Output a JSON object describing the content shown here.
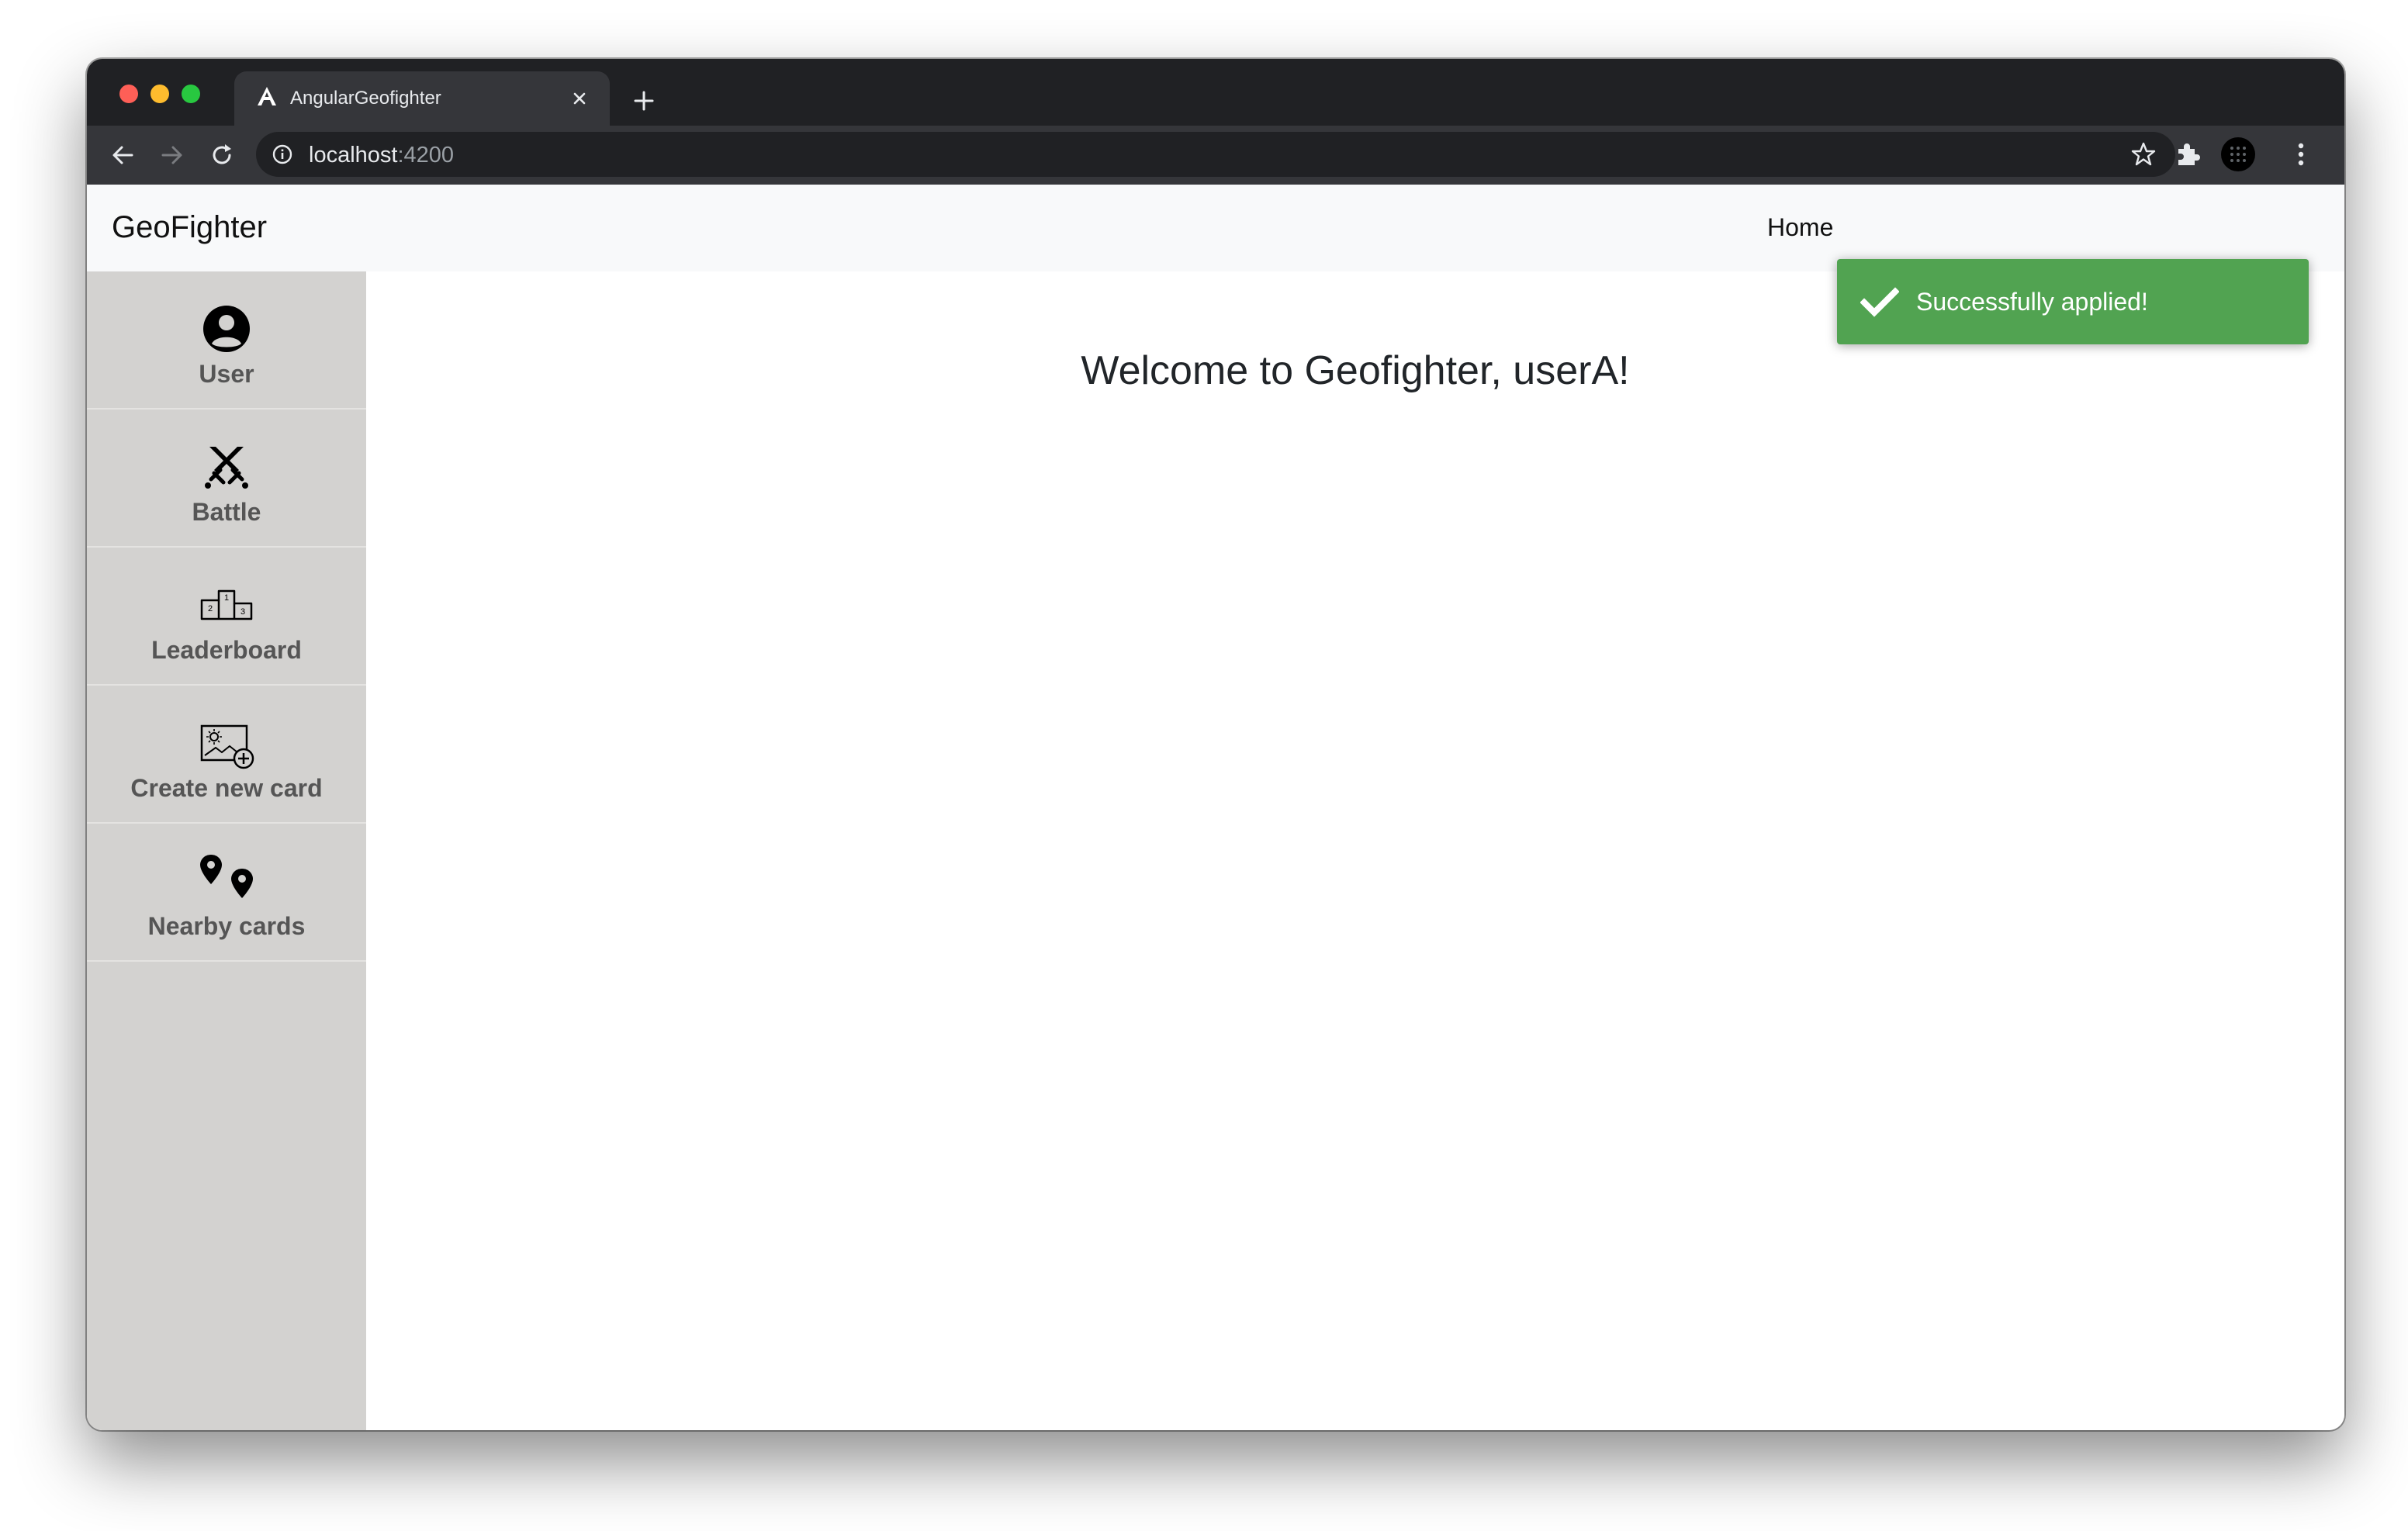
{
  "browser": {
    "tab_title": "AngularGeofighter",
    "url_host": "localhost",
    "url_port": ":4200"
  },
  "navbar": {
    "brand": "GeoFighter",
    "home_link": "Home"
  },
  "sidebar": {
    "items": [
      {
        "label": "User",
        "icon": "user-circle-icon"
      },
      {
        "label": "Battle",
        "icon": "crossed-swords-icon"
      },
      {
        "label": "Leaderboard",
        "icon": "podium-icon"
      },
      {
        "label": "Create new card",
        "icon": "add-image-card-icon"
      },
      {
        "label": "Nearby cards",
        "icon": "map-pins-icon"
      }
    ]
  },
  "main": {
    "welcome": "Welcome to Geofighter, userA!"
  },
  "toast": {
    "message": "Successfully applied!",
    "color": "#51a351"
  }
}
